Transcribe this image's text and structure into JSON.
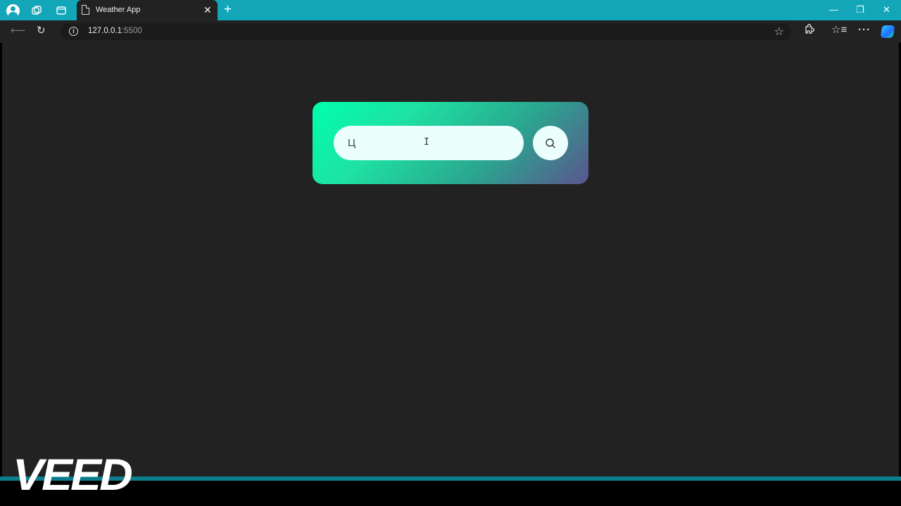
{
  "browser": {
    "tab_title": "Weather App",
    "tab_close": "✕",
    "new_tab": "+",
    "url_host": "127.0.0.1",
    "url_port": ":5500",
    "window_controls": {
      "minimize": "—",
      "maximize": "❐",
      "close": "✕"
    },
    "icons": [
      "profile-icon",
      "workspaces-icon",
      "tab-actions-icon",
      "back-icon",
      "reload-icon",
      "site-info-icon",
      "favorite-star-icon",
      "extensions-icon",
      "favorites-icon",
      "more-icon",
      "copilot-icon"
    ]
  },
  "app": {
    "search": {
      "value": "Ц",
      "placeholder": ""
    },
    "colors": {
      "gradient_start": "#00ffad",
      "gradient_end": "#5b548e",
      "page_bg": "#222222",
      "input_bg": "#ebfffc"
    }
  },
  "watermark": {
    "text": "VEED"
  }
}
